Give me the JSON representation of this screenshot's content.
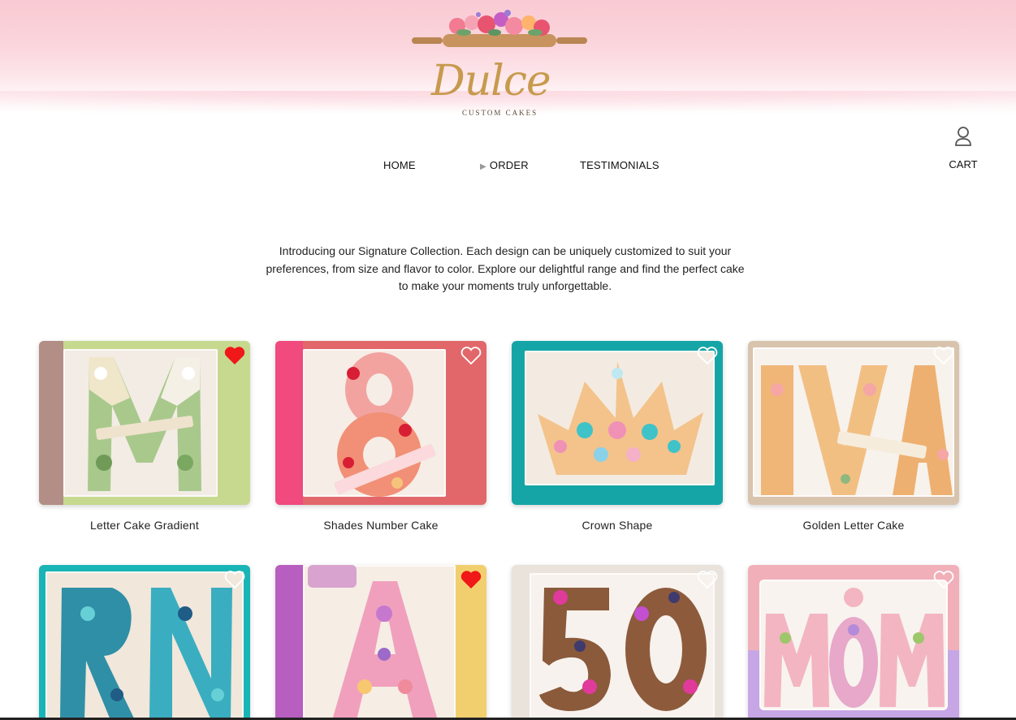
{
  "brand": {
    "name": "Dulce",
    "tagline": "CUSTOM CAKES"
  },
  "nav": {
    "home": "HOME",
    "order": "ORDER",
    "testimonials": "TESTIMONIALS",
    "cart": "CART"
  },
  "intro": "Introducing our Signature Collection. Each design can be uniquely customized to suit your preferences, from size and flavor to color. Explore our delightful range and find the perfect cake to make your moments truly unforgettable.",
  "colors": {
    "accent_gold": "#c79a4e",
    "favorite_red": "#f01818",
    "header_pink": "#f9c9d2"
  },
  "products": [
    {
      "title": "Letter Cake Gradient",
      "favorited": true,
      "bg": "#c7d98f"
    },
    {
      "title": "Shades Number Cake",
      "favorited": false,
      "bg": "#e2676a"
    },
    {
      "title": "Crown Shape",
      "favorited": false,
      "bg": "#16a5a7"
    },
    {
      "title": "Golden Letter Cake",
      "favorited": false,
      "bg": "#d8c4ad"
    },
    {
      "title": "",
      "favorited": false,
      "bg": "#19b5b6"
    },
    {
      "title": "",
      "favorited": true,
      "bg": "#f2cf6e"
    },
    {
      "title": "",
      "favorited": false,
      "bg": "#e9e3dc"
    },
    {
      "title": "",
      "favorited": false,
      "bg": "#f1b0b9"
    }
  ]
}
